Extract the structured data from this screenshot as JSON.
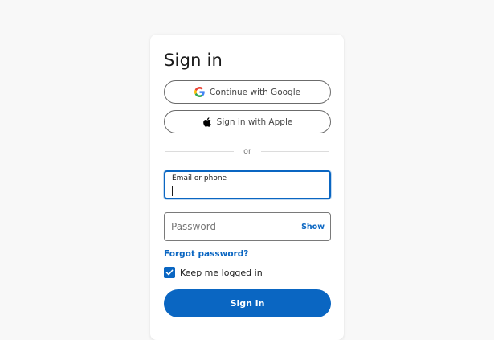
{
  "page": {
    "background": "#f8f8f8"
  },
  "card": {
    "title": "Sign in"
  },
  "social": {
    "google_label": "Continue with Google",
    "apple_label": "Sign in with Apple"
  },
  "divider": {
    "text": "or"
  },
  "form": {
    "email": {
      "label": "Email or phone",
      "value": ""
    },
    "password": {
      "placeholder": "Password",
      "show_label": "Show"
    },
    "forgot_label": "Forgot password?",
    "keep_logged_in": {
      "label": "Keep me logged in",
      "checked": true
    },
    "submit_label": "Sign in"
  },
  "colors": {
    "accent": "#0a66c2",
    "text": "#1a1a1a"
  },
  "icons": {
    "google": "google-logo-icon",
    "apple": "apple-logo-icon",
    "checkmark": "checkmark-icon"
  }
}
